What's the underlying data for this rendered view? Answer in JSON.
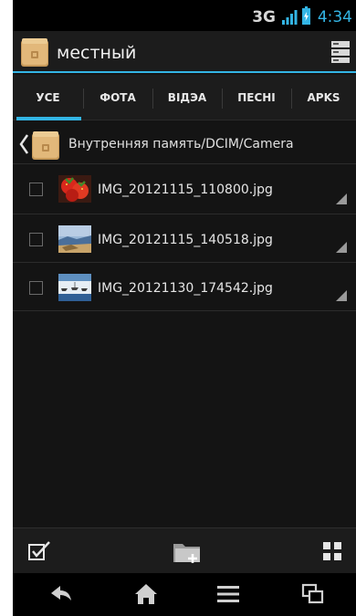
{
  "status_bar": {
    "network": "3G",
    "time": "4:34",
    "accent": "#33b5e5"
  },
  "action_bar": {
    "title": "местный",
    "app_icon": "folder-icon",
    "menu_icon": "storage-menu-icon"
  },
  "tabs": [
    {
      "label": "УСЕ",
      "active": true
    },
    {
      "label": "ФОТА",
      "active": false
    },
    {
      "label": "ВІДЭА",
      "active": false
    },
    {
      "label": "ПЕСНІ",
      "active": false
    },
    {
      "label": "APKS",
      "active": false
    }
  ],
  "path_bar": {
    "path": "Внутренняя память/DCIM/Camera"
  },
  "files": [
    {
      "name": "IMG_20121115_110800.jpg",
      "checked": false,
      "thumb": "strawberries"
    },
    {
      "name": "IMG_20121115_140518.jpg",
      "checked": false,
      "thumb": "landscape"
    },
    {
      "name": "IMG_20121130_174542.jpg",
      "checked": false,
      "thumb": "boats"
    }
  ],
  "toolbar": {
    "select_icon": "select-all-icon",
    "new_folder_icon": "new-folder-icon",
    "view_icon": "grid-view-icon"
  },
  "nav_bar": {
    "icons": [
      "back-icon",
      "home-icon",
      "menu-icon",
      "recent-apps-icon"
    ]
  }
}
